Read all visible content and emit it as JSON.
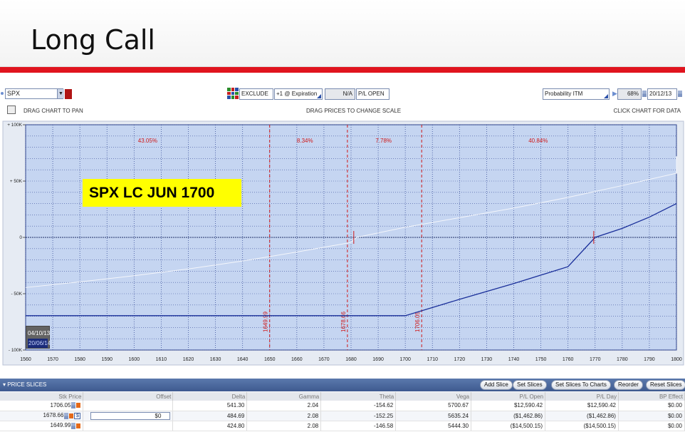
{
  "slide": {
    "title": "Long Call"
  },
  "toolbar": {
    "symbol": "SPX",
    "exclude": "EXCLUDE",
    "expiration": "+1 @ Expiration",
    "na": "N/A",
    "pl_open": "P/L OPEN",
    "probability": "Probability ITM",
    "percent": "68%",
    "date": "20/12/13"
  },
  "hints": {
    "pan": "DRAG CHART TO PAN",
    "scale": "DRAG PRICES TO CHANGE SCALE",
    "data": "CLICK CHART FOR DATA"
  },
  "chart_label": "SPX LC JUN 1700",
  "dates": {
    "d1": "04/10/13",
    "d2": "20/06/14"
  },
  "chart_data": {
    "type": "line",
    "x_range": [
      1560,
      1800
    ],
    "y_range": [
      -100000,
      100000
    ],
    "x_ticks": [
      1560,
      1570,
      1580,
      1590,
      1600,
      1610,
      1620,
      1630,
      1640,
      1650,
      1660,
      1670,
      1680,
      1690,
      1700,
      1710,
      1720,
      1730,
      1740,
      1750,
      1760,
      1770,
      1780,
      1790,
      1800
    ],
    "y_ticks": [
      {
        "value": 100000,
        "label": "+ 100K"
      },
      {
        "value": 50000,
        "label": "+ 50K"
      },
      {
        "value": 0,
        "label": "0"
      },
      {
        "value": -50000,
        "label": "- 50K"
      },
      {
        "value": -100000,
        "label": "- 100K"
      }
    ],
    "series": [
      {
        "points": [
          [
            1560,
            -44500
          ],
          [
            1580,
            -39500
          ],
          [
            1600,
            -34000
          ],
          [
            1620,
            -28000
          ],
          [
            1640,
            -21000
          ],
          [
            1660,
            -13000
          ],
          [
            1680,
            -4500
          ],
          [
            1682,
            0
          ],
          [
            1700,
            9000
          ],
          [
            1720,
            17500
          ],
          [
            1740,
            26000
          ],
          [
            1760,
            35500
          ],
          [
            1780,
            46000
          ],
          [
            1800,
            57000
          ],
          [
            1802,
            72000
          ]
        ]
      },
      {
        "points": [
          [
            1560,
            -69500
          ],
          [
            1700,
            -69500
          ],
          [
            1720,
            -55000
          ],
          [
            1740,
            -41000
          ],
          [
            1760,
            -26000
          ],
          [
            1770,
            0
          ],
          [
            1780,
            8000
          ],
          [
            1790,
            18000
          ],
          [
            1802,
            30000
          ]
        ]
      }
    ],
    "price_lines": [
      {
        "x": 1649.99,
        "label": "1649.99"
      },
      {
        "x": 1678.66,
        "label": "1678.66"
      },
      {
        "x": 1706.05,
        "label": "1706.05"
      }
    ],
    "probabilities": [
      {
        "x": 1605,
        "label": "43.05%"
      },
      {
        "x": 1663,
        "label": "8.34%"
      },
      {
        "x": 1692,
        "label": "7.78%"
      },
      {
        "x": 1749,
        "label": "40.84%"
      }
    ]
  },
  "price_slices": {
    "title": "PRICE SLICES",
    "buttons": [
      "Add Slice",
      "Set Slices",
      "Set Slices To Charts",
      "Reorder",
      "Reset Slices"
    ],
    "columns": [
      "Stk Price",
      "Offset",
      "Delta",
      "Gamma",
      "Theta",
      "Vega",
      "P/L Open",
      "P/L Day",
      "BP Effect"
    ],
    "rows": [
      {
        "stk": "1706.05",
        "offset": "",
        "delta": "541.30",
        "gamma": "2.04",
        "theta": "-154.62",
        "vega": "5700.67",
        "pl_open": "$12,590.42",
        "pl_day": "$12,590.42",
        "bp": "$0.00"
      },
      {
        "stk": "1678.66",
        "offset": "$0",
        "delta": "484.69",
        "gamma": "2.08",
        "theta": "-152.25",
        "vega": "5635.24",
        "pl_open": "($1,462.86)",
        "pl_day": "($1,462.86)",
        "bp": "$0.00"
      },
      {
        "stk": "1649.99",
        "offset": "",
        "delta": "424.80",
        "gamma": "2.08",
        "theta": "-146.58",
        "vega": "5444.30",
        "pl_open": "($14,500.15)",
        "pl_day": "($14,500.15)",
        "bp": "$0.00"
      }
    ]
  }
}
